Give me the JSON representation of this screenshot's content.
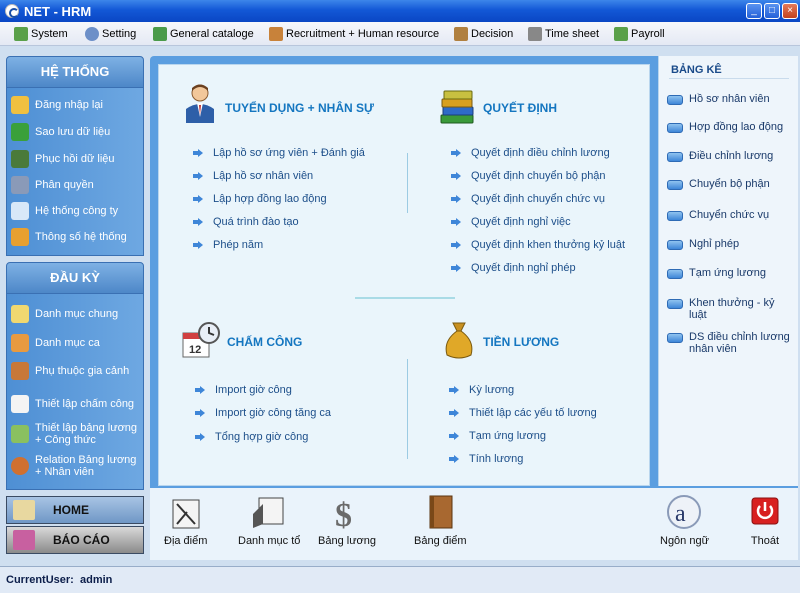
{
  "window": {
    "title": "NET - HRM"
  },
  "menu": [
    {
      "label": "System",
      "icon": "system-icon",
      "color": "#5aa04a"
    },
    {
      "label": "Setting",
      "icon": "setting-icon",
      "color": "#6c8fc8"
    },
    {
      "label": "General cataloge",
      "icon": "catalogue-icon",
      "color": "#4a9a4a"
    },
    {
      "label": "Recruitment + Human resource",
      "icon": "people-icon",
      "color": "#c8823a"
    },
    {
      "label": "Decision",
      "icon": "decision-icon",
      "color": "#b08040"
    },
    {
      "label": "Time sheet",
      "icon": "timesheet-icon",
      "color": "#888888"
    },
    {
      "label": "Payroll",
      "icon": "payroll-icon",
      "color": "#5aa04a"
    }
  ],
  "he_thong": {
    "title": "HỆ THỐNG",
    "items": [
      {
        "label": "Đăng nhập lại",
        "icon": "relogin-icon"
      },
      {
        "label": "Sao lưu dữ liệu",
        "icon": "backup-icon"
      },
      {
        "label": "Phục hồi dữ liệu",
        "icon": "restore-icon"
      },
      {
        "label": "Phân quyền",
        "icon": "permission-icon"
      },
      {
        "label": "Hệ thống công ty",
        "icon": "company-icon"
      },
      {
        "label": "Thông số hệ thống",
        "icon": "parameters-icon"
      }
    ]
  },
  "dau_ky": {
    "title": "ĐẦU KỲ",
    "items": [
      {
        "label": "Danh mục chung",
        "icon": "general-list-icon"
      },
      {
        "label": "Danh mục ca",
        "icon": "shift-list-icon"
      },
      {
        "label": "Phụ thuộc gia cảnh",
        "icon": "family-icon"
      },
      {
        "label": "Thiết lập chấm công",
        "icon": "calendar-icon"
      },
      {
        "label": "Thiết lập bảng lương + Công thức",
        "icon": "formula-icon"
      },
      {
        "label": "Relation Bảng lương + Nhân viên",
        "icon": "relation-icon"
      }
    ]
  },
  "nav_buttons": {
    "home": "HOME",
    "report": "BÁO CÁO"
  },
  "groups": {
    "recruitment": {
      "title": "TUYỂN DỤNG + NHÂN SỰ",
      "links": [
        "Lập hồ sơ ứng viên + Đánh giá",
        "Lập hồ sơ nhân viên",
        "Lập hợp đồng lao động",
        "Quá trình đào tạo",
        "Phép năm"
      ]
    },
    "decision": {
      "title": "QUYẾT ĐỊNH",
      "links": [
        "Quyết định điều chỉnh lương",
        "Quyết định chuyển bộ phận",
        "Quyết định chuyển chức vụ",
        "Quyết định nghỉ việc",
        "Quyết định khen thưởng kỷ luật",
        "Quyết định nghỉ phép"
      ]
    },
    "timekeeping": {
      "title": "CHẤM CÔNG",
      "links": [
        "Import giờ công",
        "Import giờ công tăng ca",
        "Tổng hợp giờ công"
      ]
    },
    "salary": {
      "title": "TIỀN LƯƠNG",
      "links": [
        "Kỳ lương",
        "Thiết lập các yếu tố lương",
        "Tạm ứng lương",
        "Tính lương"
      ]
    }
  },
  "calendar_day": "12",
  "bang_ke": {
    "title": "BẢNG KÊ",
    "items": [
      "Hồ sơ nhân viên",
      "Hợp đồng lao động",
      "Điều chỉnh lương",
      "Chuyển bộ phận",
      "Chuyển chức vụ",
      "Nghỉ phép",
      "Tạm ứng lương",
      "Khen thưởng - kỷ luật",
      "DS điều chỉnh lương nhân viên"
    ]
  },
  "toolbar": {
    "dia_diem": "Địa điểm",
    "danh_muc_to": "Danh mục tổ",
    "bang_luong": "Bảng lương",
    "bang_diem": "Bảng điểm",
    "ngon_ngu": "Ngôn ngữ",
    "thoat": "Thoát"
  },
  "status": {
    "label": "CurrentUser:",
    "user": "admin"
  }
}
